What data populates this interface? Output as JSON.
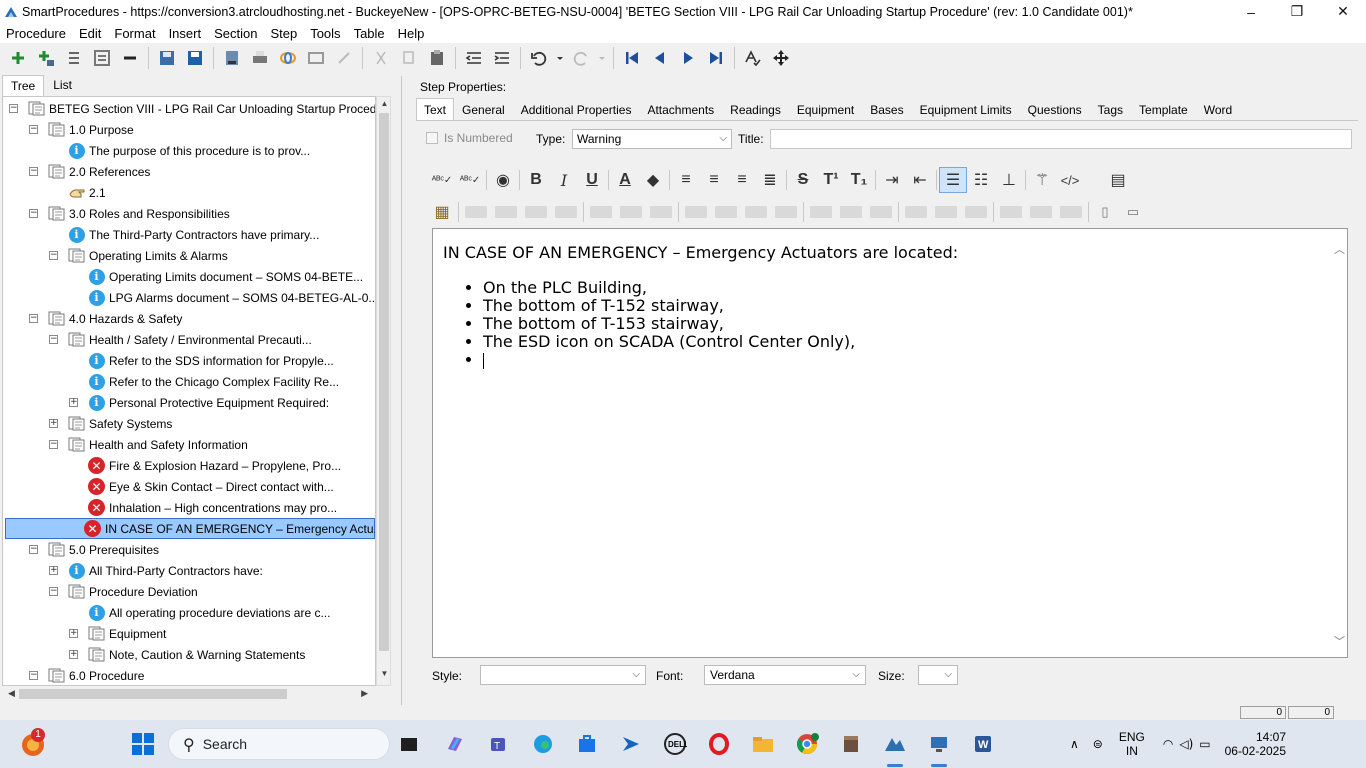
{
  "window": {
    "title": "SmartProcedures - https://conversion3.atrcloudhosting.net - BuckeyeNew - [OPS-OPRC-BETEG-NSU-0004] 'BETEG Section VIII - LPG Rail Car Unloading Startup Procedure' (rev: 1.0 Candidate 001)*",
    "minimize": "–",
    "restore": "❐",
    "close": "✕"
  },
  "menu": [
    "Procedure",
    "Edit",
    "Format",
    "Insert",
    "Section",
    "Step",
    "Tools",
    "Table",
    "Help"
  ],
  "left": {
    "tabs": [
      "Tree",
      "List"
    ],
    "tree": [
      {
        "level": 0,
        "exp": "−",
        "icon": "doc",
        "label": "BETEG Section VIII - LPG Rail Car Unloading Startup Procedur..."
      },
      {
        "level": 1,
        "exp": "−",
        "icon": "doc",
        "label": "1.0 Purpose"
      },
      {
        "level": 2,
        "exp": "",
        "icon": "info",
        "label": "The purpose of this procedure is to prov..."
      },
      {
        "level": 1,
        "exp": "−",
        "icon": "doc",
        "label": "2.0 References"
      },
      {
        "level": 2,
        "exp": "",
        "icon": "hand",
        "label": "2.1"
      },
      {
        "level": 1,
        "exp": "−",
        "icon": "doc",
        "label": "3.0 Roles and Responsibilities"
      },
      {
        "level": 2,
        "exp": "",
        "icon": "info",
        "label": "The Third-Party Contractors have primary..."
      },
      {
        "level": 2,
        "exp": "−",
        "icon": "doc",
        "label": "Operating Limits & Alarms"
      },
      {
        "level": 3,
        "exp": "",
        "icon": "info",
        "label": "Operating Limits document – SOMS 04-BETE..."
      },
      {
        "level": 3,
        "exp": "",
        "icon": "info",
        "label": "LPG Alarms document – SOMS 04-BETEG-AL-0..."
      },
      {
        "level": 1,
        "exp": "−",
        "icon": "doc",
        "label": "4.0 Hazards & Safety"
      },
      {
        "level": 2,
        "exp": "−",
        "icon": "doc",
        "label": "Health / Safety / Environmental Precauti..."
      },
      {
        "level": 3,
        "exp": "",
        "icon": "info",
        "label": "Refer to the SDS information for Propyle..."
      },
      {
        "level": 3,
        "exp": "",
        "icon": "info",
        "label": "Refer to the Chicago Complex Facility Re..."
      },
      {
        "level": 3,
        "exp": "+",
        "icon": "info",
        "label": "Personal Protective Equipment Required:"
      },
      {
        "level": 2,
        "exp": "+",
        "icon": "doc",
        "label": "Safety Systems"
      },
      {
        "level": 2,
        "exp": "−",
        "icon": "doc",
        "label": "Health and Safety Information"
      },
      {
        "level": 3,
        "exp": "",
        "icon": "warn",
        "label": "Fire & Explosion Hazard – Propylene, Pro..."
      },
      {
        "level": 3,
        "exp": "",
        "icon": "warn",
        "label": "Eye & Skin Contact – Direct contact with..."
      },
      {
        "level": 3,
        "exp": "",
        "icon": "warn",
        "label": "Inhalation – High concentrations may pro..."
      },
      {
        "level": 3,
        "exp": "",
        "icon": "warn",
        "label": "IN CASE OF AN EMERGENCY – Emergency Actu...",
        "selected": true
      },
      {
        "level": 1,
        "exp": "−",
        "icon": "doc",
        "label": "5.0 Prerequisites"
      },
      {
        "level": 2,
        "exp": "+",
        "icon": "info",
        "label": "All Third-Party Contractors have:"
      },
      {
        "level": 2,
        "exp": "−",
        "icon": "doc",
        "label": "Procedure Deviation"
      },
      {
        "level": 3,
        "exp": "",
        "icon": "info",
        "label": "All operating procedure deviations are c..."
      },
      {
        "level": 3,
        "exp": "+",
        "icon": "doc",
        "label": "Equipment"
      },
      {
        "level": 3,
        "exp": "+",
        "icon": "doc",
        "label": "Note, Caution & Warning Statements"
      },
      {
        "level": 1,
        "exp": "−",
        "icon": "doc",
        "label": "6.0 Procedure"
      }
    ]
  },
  "right": {
    "header": "Step Properties:",
    "tabs": [
      "Text",
      "General",
      "Additional Properties",
      "Attachments",
      "Readings",
      "Equipment",
      "Bases",
      "Equipment Limits",
      "Questions",
      "Tags",
      "Template",
      "Word"
    ],
    "is_numbered": "Is Numbered",
    "type_label": "Type:",
    "type_value": "Warning",
    "title_label": "Title:",
    "editor": {
      "heading": "IN CASE OF AN EMERGENCY – Emergency Actuators are located:",
      "bullets": [
        "On the PLC Building,",
        "The bottom of T-152 stairway,",
        "The bottom of T-153 stairway,",
        "The ESD icon on SCADA (Control Center Only),"
      ]
    },
    "style_label": "Style:",
    "style_value": "",
    "font_label": "Font:",
    "font_value": "Verdana",
    "size_label": "Size:",
    "size_value": ""
  },
  "status": {
    "cell1": "0",
    "cell2": "0"
  },
  "taskbar": {
    "search": "Search",
    "notif_badge": "1",
    "lang1": "ENG",
    "lang2": "IN",
    "time": "14:07",
    "date": "06-02-2025"
  },
  "colors": {
    "selection": "#99c9ff",
    "info": "#2fa0e6",
    "warning": "#d6252a",
    "accent": "#3a7bd5"
  }
}
